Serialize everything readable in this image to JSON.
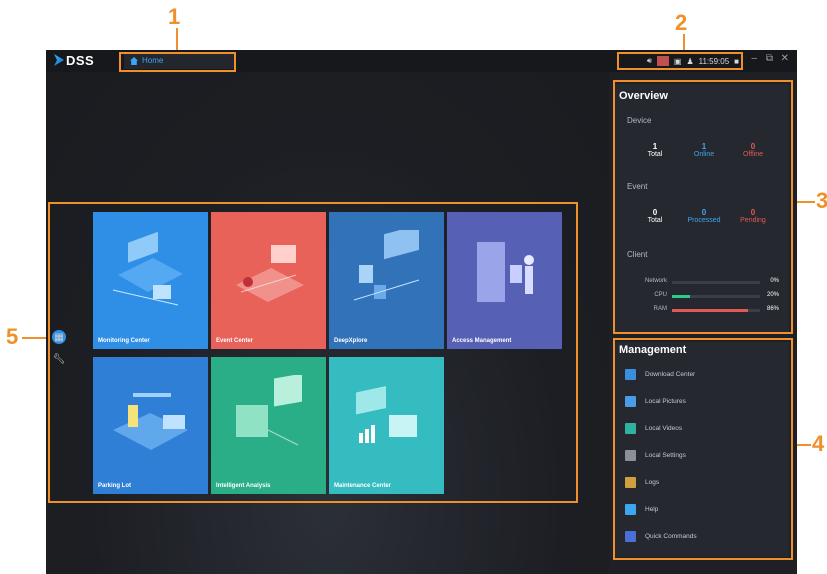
{
  "callouts": {
    "c1": "1",
    "c2": "2",
    "c3": "3",
    "c4": "4",
    "c5": "5"
  },
  "app": {
    "name": "DSS",
    "home_tab": "Home"
  },
  "tray": {
    "clock": "11:59:05",
    "minimize": "–",
    "restore": "⧉",
    "close": "✕"
  },
  "sidebar": {
    "apps_icon": "apps-grid-icon",
    "tools_icon": "wrench-icon"
  },
  "tiles": [
    {
      "label": "Monitoring Center",
      "color": "#2f8ee5"
    },
    {
      "label": "Event Center",
      "color": "#e8625a"
    },
    {
      "label": "DeepXplore",
      "color": "#3272b8"
    },
    {
      "label": "Access Management",
      "color": "#5660b4"
    },
    {
      "label": "Parking Lot",
      "color": "#2f7fd6"
    },
    {
      "label": "Intelligent Analysis",
      "color": "#2aae88"
    },
    {
      "label": "Maintenance Center",
      "color": "#34bcc0"
    }
  ],
  "overview": {
    "title": "Overview",
    "device": {
      "label": "Device",
      "total": "1",
      "total_label": "Total",
      "online": "1",
      "online_label": "Online",
      "offline": "0",
      "offline_label": "Offline"
    },
    "event": {
      "label": "Event",
      "total": "0",
      "total_label": "Total",
      "processed": "0",
      "processed_label": "Processed",
      "pending": "0",
      "pending_label": "Pending"
    },
    "client": {
      "label": "Client",
      "rows": [
        {
          "label": "Network",
          "pct": "0%",
          "value": 0,
          "color": "#2aae88"
        },
        {
          "label": "CPU",
          "pct": "20%",
          "value": 20,
          "color": "#2ecc8a"
        },
        {
          "label": "RAM",
          "pct": "86%",
          "value": 86,
          "color": "#e05a55"
        }
      ]
    }
  },
  "management": {
    "title": "Management",
    "items": [
      {
        "label": "Download Center",
        "color": "#3a8ee0"
      },
      {
        "label": "Local Pictures",
        "color": "#4a9be8"
      },
      {
        "label": "Local Videos",
        "color": "#2fb2a0"
      },
      {
        "label": "Local Settings",
        "color": "#8a8f98"
      },
      {
        "label": "Logs",
        "color": "#d0a040"
      },
      {
        "label": "Help",
        "color": "#3ba6f2"
      },
      {
        "label": "Quick Commands",
        "color": "#4a6fd8"
      }
    ]
  },
  "colors": {
    "accent": "#f0902a",
    "online": "#3ba6f2",
    "offline": "#e05a55"
  }
}
